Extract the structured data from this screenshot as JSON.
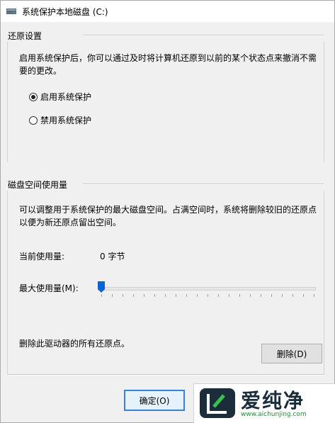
{
  "window": {
    "title": "系统保护本地磁盘 (C:)"
  },
  "restore": {
    "heading": "还原设置",
    "description": "启用系统保护后，你可以通过及时将计算机还原到以前的某个状态点来撤消不需要的更改。",
    "option_enable": "启用系统保护",
    "option_disable": "禁用系统保护",
    "selected": "enable"
  },
  "disk": {
    "heading": "磁盘空间使用量",
    "description": "可以调整用于系统保护的最大磁盘空间。占满空间时，系统将删除较旧的还原点以便为新还原点留出空间。",
    "current_label": "当前使用量:",
    "current_value": "0 字节",
    "max_label": "最大使用量(M):",
    "max_usage_fraction": 0.0,
    "delete_text": "删除此驱动器的所有还原点。",
    "delete_button": "删除(D)"
  },
  "buttons": {
    "ok": "确定(O)"
  },
  "watermark": {
    "name": "爱纯净",
    "url": "www.aichunjing.com"
  },
  "colors": {
    "accent": "#0a64d6",
    "dialog_bg": "#f0f0f0"
  }
}
